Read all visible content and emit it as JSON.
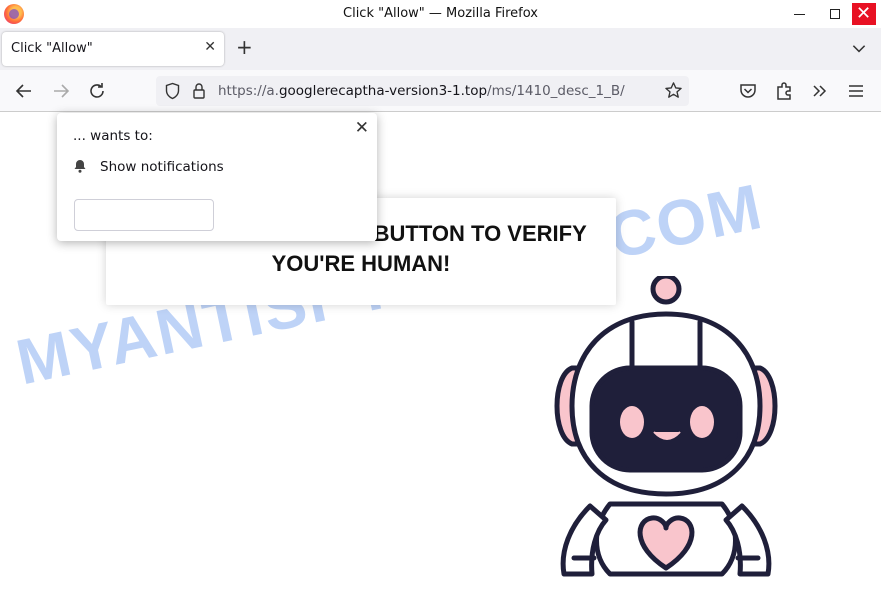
{
  "window": {
    "title": "Click \"Allow\" — Mozilla Firefox"
  },
  "tab": {
    "label": "Click \"Allow\""
  },
  "url": {
    "scheme": "https://a.",
    "host": "googlerecaptha-version3-1.top",
    "path": "/ms/1410_desc_1_B/"
  },
  "popup": {
    "wants": "... wants to:",
    "permission": "Show notifications"
  },
  "page": {
    "message": "PRESS THE \"ALLOW\" BUTTON TO VERIFY YOU'RE HUMAN!"
  },
  "watermark": "MYANTISPYWARE.COM",
  "colors": {
    "robot_outline": "#1f1f3a",
    "robot_pink": "#f9c5cc",
    "watermark": "#6495ed",
    "close_red": "#e81123"
  },
  "icons": [
    "firefox-logo",
    "minimize-icon",
    "maximize-icon",
    "close-icon",
    "new-tab-icon",
    "tab-list-icon",
    "back-icon",
    "forward-icon",
    "reload-icon",
    "shield-icon",
    "lock-icon",
    "bookmark-star-icon",
    "pocket-icon",
    "extensions-icon",
    "overflow-icon",
    "menu-icon",
    "bell-icon"
  ]
}
